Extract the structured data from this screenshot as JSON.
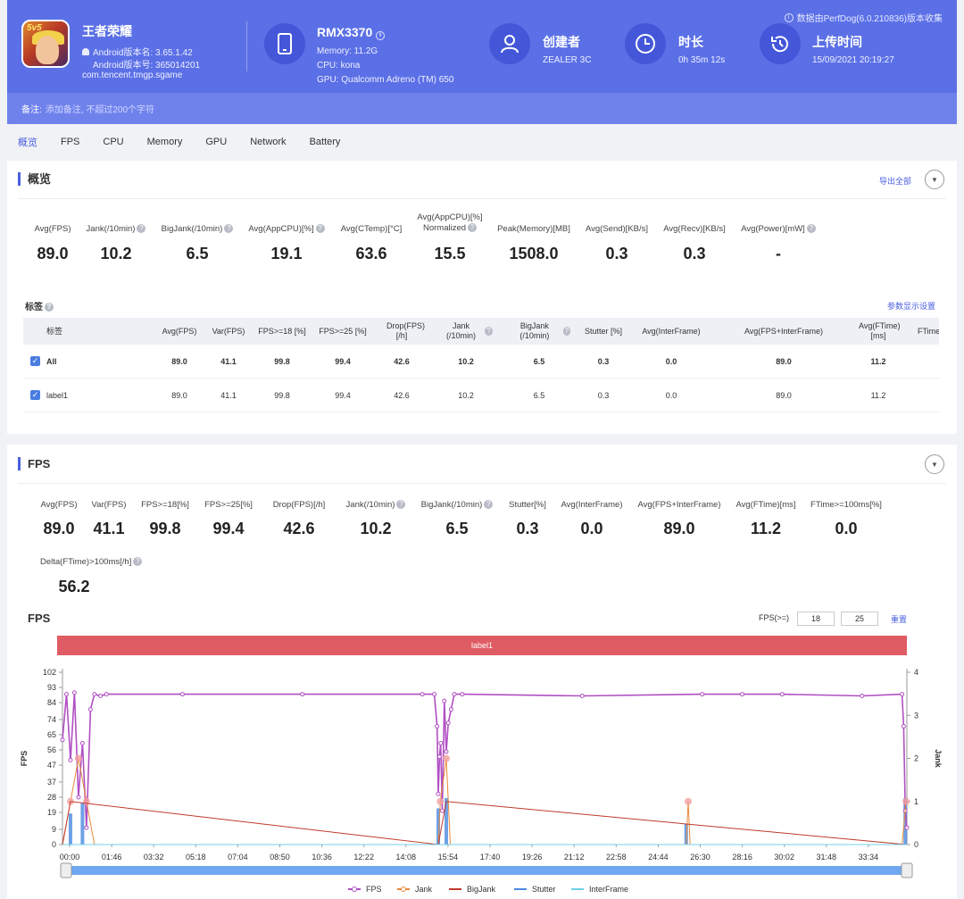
{
  "header": {
    "collect_note": "数据由PerfDog(6.0.210836)版本收集",
    "app": {
      "icon_text": "5v5",
      "name": "王者荣耀",
      "version_name": "Android版本名: 3.65.1.42",
      "version_code": "Android版本号: 365014201",
      "package": "com.tencent.tmgp.sgame"
    },
    "device": {
      "model": "RMX3370",
      "memory": "Memory: 11.2G",
      "cpu": "CPU: kona",
      "gpu": "GPU: Qualcomm Adreno (TM) 650"
    },
    "creator": {
      "label": "创建者",
      "value": "ZEALER 3C"
    },
    "duration": {
      "label": "时长",
      "value": "0h 35m 12s"
    },
    "upload": {
      "label": "上传时间",
      "value": "15/09/2021 20:19:27"
    },
    "note_label": "备注:",
    "note_placeholder": "添加备注, 不超过200个字符"
  },
  "tabs": [
    "概览",
    "FPS",
    "CPU",
    "Memory",
    "GPU",
    "Network",
    "Battery"
  ],
  "overview": {
    "title": "概览",
    "export": "导出全部",
    "stats": [
      {
        "label": "Avg(FPS)",
        "value": "89.0"
      },
      {
        "label": "Jank(/10min)",
        "value": "10.2"
      },
      {
        "label": "BigJank(/10min)",
        "value": "6.5"
      },
      {
        "label": "Avg(AppCPU)[%]",
        "value": "19.1"
      },
      {
        "label": "Avg(CTemp)[°C]",
        "value": "63.6"
      },
      {
        "label": "Avg(AppCPU)[%] Normalized",
        "label1": "Avg(AppCPU)[%]",
        "label2": "Normalized",
        "value": "15.5"
      },
      {
        "label": "Peak(Memory)[MB]",
        "value": "1508.0"
      },
      {
        "label": "Avg(Send)[KB/s]",
        "value": "0.3"
      },
      {
        "label": "Avg(Recv)[KB/s]",
        "value": "0.3"
      },
      {
        "label": "Avg(Power)[mW]",
        "value": "-"
      }
    ],
    "tags_title": "标签",
    "param_settings": "参数显示设置",
    "table": {
      "headers": [
        "标签",
        "Avg(FPS)",
        "Var(FPS)",
        "FPS>=18 [%]",
        "FPS>=25 [%]",
        "Drop(FPS) [/h]",
        "Jank (/10min)",
        "BigJank (/10min)",
        "Stutter [%]",
        "Avg(InterFrame)",
        "Avg(FPS+InterFrame)",
        "Avg(FTime) [ms]",
        "FTime>="
      ],
      "rows": [
        {
          "name": "All",
          "cells": [
            "89.0",
            "41.1",
            "99.8",
            "99.4",
            "42.6",
            "10.2",
            "6.5",
            "0.3",
            "0.0",
            "89.0",
            "11.2"
          ]
        },
        {
          "name": "label1",
          "cells": [
            "89.0",
            "41.1",
            "99.8",
            "99.4",
            "42.6",
            "10.2",
            "6.5",
            "0.3",
            "0.0",
            "89.0",
            "11.2"
          ]
        }
      ]
    }
  },
  "fps_section": {
    "title": "FPS",
    "stats": [
      {
        "label": "Avg(FPS)",
        "value": "89.0"
      },
      {
        "label": "Var(FPS)",
        "value": "41.1"
      },
      {
        "label": "FPS>=18[%]",
        "value": "99.8"
      },
      {
        "label": "FPS>=25[%]",
        "value": "99.4"
      },
      {
        "label": "Drop(FPS)[/h]",
        "value": "42.6"
      },
      {
        "label": "Jank(/10min)",
        "value": "10.2"
      },
      {
        "label": "BigJank(/10min)",
        "value": "6.5"
      },
      {
        "label": "Stutter[%]",
        "value": "0.3"
      },
      {
        "label": "Avg(InterFrame)",
        "value": "0.0"
      },
      {
        "label": "Avg(FPS+InterFrame)",
        "value": "89.0"
      },
      {
        "label": "Avg(FTime)[ms]",
        "value": "11.2"
      },
      {
        "label": "FTime>=100ms[%]",
        "value": "0.0"
      },
      {
        "label": "Delta(FTime)>100ms[/h]",
        "value": "56.2"
      }
    ],
    "chart_title": "FPS",
    "fps_threshold_label": "FPS(>=)",
    "fps_threshold_1": "18",
    "fps_threshold_2": "25",
    "reset": "重置",
    "label_band": "label1"
  },
  "chart_data": {
    "type": "line",
    "title": "FPS",
    "ylabel": "FPS",
    "y2label": "Jank",
    "ylim": [
      0,
      102
    ],
    "y2lim": [
      0,
      4
    ],
    "yticks": [
      0,
      9,
      19,
      28,
      37,
      47,
      56,
      65,
      74,
      84,
      93,
      102
    ],
    "y2ticks": [
      0,
      1,
      2,
      3,
      4
    ],
    "xticks": [
      "00:00",
      "01:46",
      "03:32",
      "05:18",
      "07:04",
      "08:50",
      "10:36",
      "12:22",
      "14:08",
      "15:54",
      "17:40",
      "19:26",
      "21:12",
      "22:58",
      "24:44",
      "26:30",
      "28:16",
      "30:02",
      "31:48",
      "33:34"
    ],
    "legend": [
      "FPS",
      "Jank",
      "BigJank",
      "Stutter",
      "InterFrame"
    ],
    "legend_position": "bottom",
    "x_range_seconds": [
      0,
      2112
    ],
    "series": [
      {
        "name": "FPS",
        "color": "#b04fc3",
        "x": [
          0,
          10,
          20,
          30,
          40,
          50,
          60,
          70,
          80,
          95,
          110,
          300,
          600,
          900,
          930,
          937,
          940,
          943,
          946,
          950,
          955,
          960,
          965,
          972,
          980,
          1000,
          1300,
          1600,
          1700,
          1800,
          2000,
          2100,
          2104,
          2108,
          2112
        ],
        "values": [
          62,
          89,
          50,
          90,
          28,
          60,
          10,
          80,
          89,
          88,
          89,
          89,
          89,
          89,
          89,
          70,
          30,
          52,
          60,
          20,
          85,
          55,
          72,
          80,
          89,
          89,
          88,
          89,
          89,
          89,
          88,
          89,
          70,
          20,
          10
        ]
      },
      {
        "name": "Jank",
        "color": "#e8893a",
        "x": [
          0,
          20,
          40,
          60,
          80,
          940,
          945,
          960,
          970,
          1560,
          1565,
          1570,
          2100,
          2110
        ],
        "values": [
          0,
          1,
          2,
          1,
          0,
          0,
          1,
          2,
          0,
          0,
          1,
          0,
          0,
          1
        ]
      },
      {
        "name": "BigJank",
        "color": "#c0392b",
        "x": [
          0,
          20,
          940,
          960,
          2110
        ],
        "values": [
          0,
          1,
          0,
          1,
          0
        ]
      },
      {
        "name": "Stutter",
        "color": "#4a8ae0",
        "x": [
          0,
          20,
          50,
          940,
          960,
          1560,
          2108
        ],
        "values": [
          0,
          0.6,
          0.8,
          0.7,
          0.9,
          0.4,
          0.9
        ]
      },
      {
        "name": "InterFrame",
        "color": "#6fd0e8",
        "x": [
          0,
          2112
        ],
        "values": [
          0,
          0
        ]
      }
    ]
  }
}
